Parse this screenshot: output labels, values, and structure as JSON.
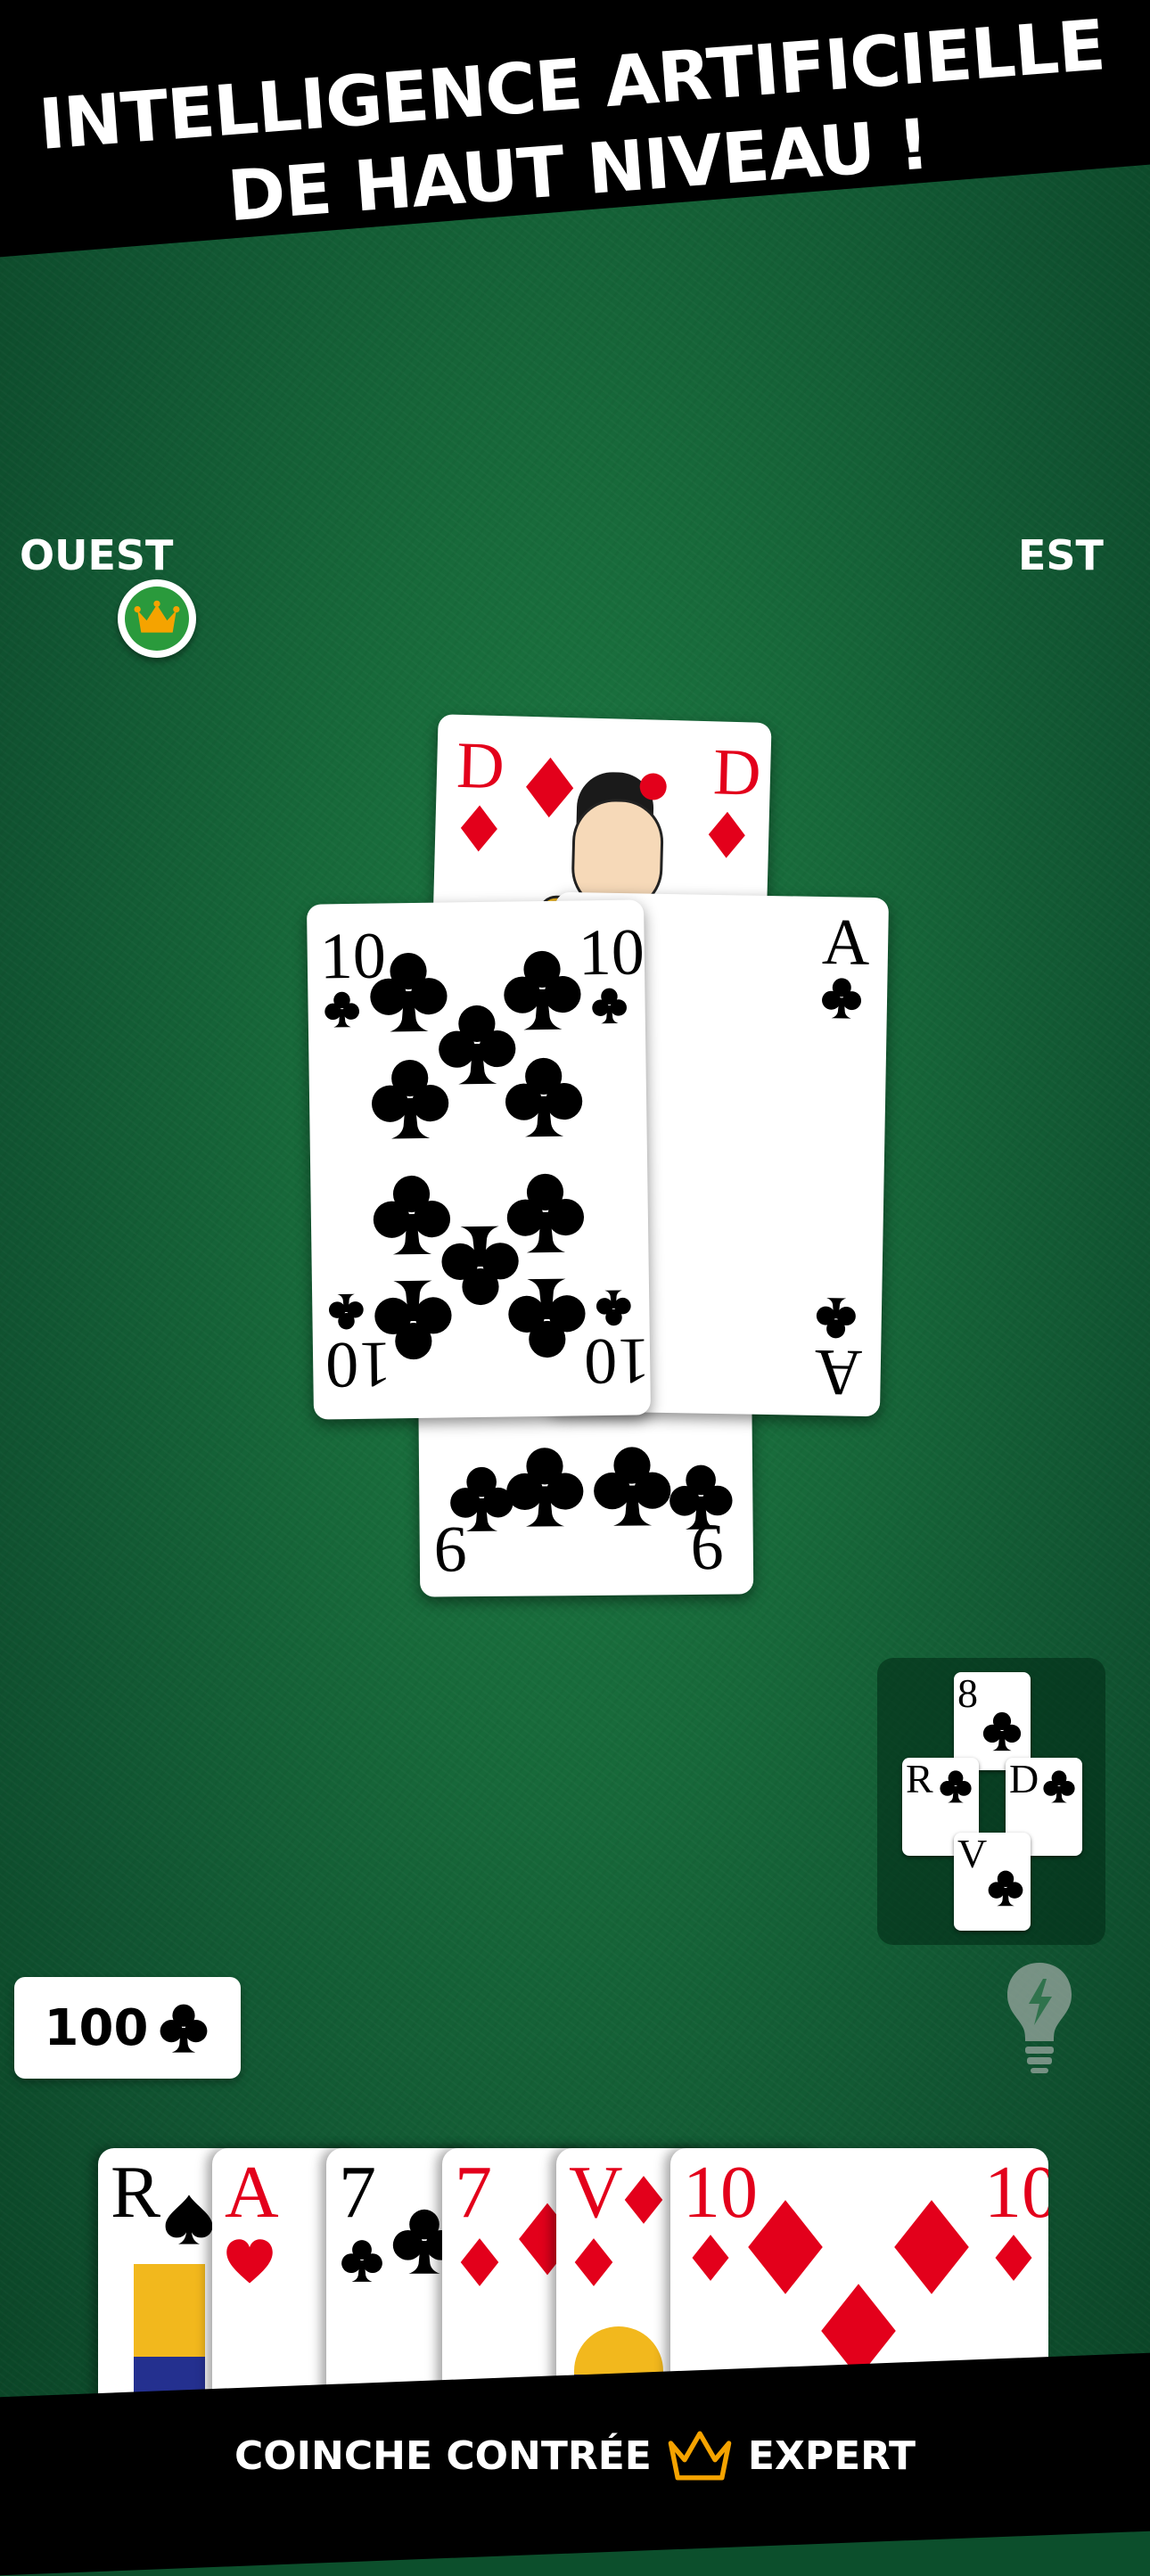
{
  "banner": {
    "line1": "INTELLIGENCE ARTIFICIELLE",
    "line2": "DE HAUT NIVEAU !"
  },
  "players": {
    "west": "OUEST",
    "east": "EST"
  },
  "dealer_badge_icon": "crown-icon",
  "trick": [
    {
      "rank": "D",
      "suit": "diamonds",
      "position": "north"
    },
    {
      "rank": "A",
      "suit": "clubs",
      "position": "east"
    },
    {
      "rank": "9",
      "suit": "clubs",
      "position": "south"
    },
    {
      "rank": "10",
      "suit": "clubs",
      "position": "west"
    }
  ],
  "bid": {
    "value": "100",
    "suit": "clubs"
  },
  "last_trick": [
    {
      "rank": "8",
      "suit": "clubs"
    },
    {
      "rank": "R",
      "suit": "clubs"
    },
    {
      "rank": "D",
      "suit": "clubs"
    },
    {
      "rank": "V",
      "suit": "clubs"
    }
  ],
  "hand": [
    {
      "rank": "R",
      "suit": "spades"
    },
    {
      "rank": "A",
      "suit": "hearts"
    },
    {
      "rank": "7",
      "suit": "clubs"
    },
    {
      "rank": "7",
      "suit": "diamonds"
    },
    {
      "rank": "V",
      "suit": "diamonds"
    },
    {
      "rank": "10",
      "suit": "diamonds"
    }
  ],
  "footer": {
    "brand_left": "COINCHE CONTRÉE",
    "brand_right": "EXPERT"
  },
  "colors": {
    "felt": "#17693a",
    "red_suit": "#e3001b",
    "banner": "#000000"
  }
}
